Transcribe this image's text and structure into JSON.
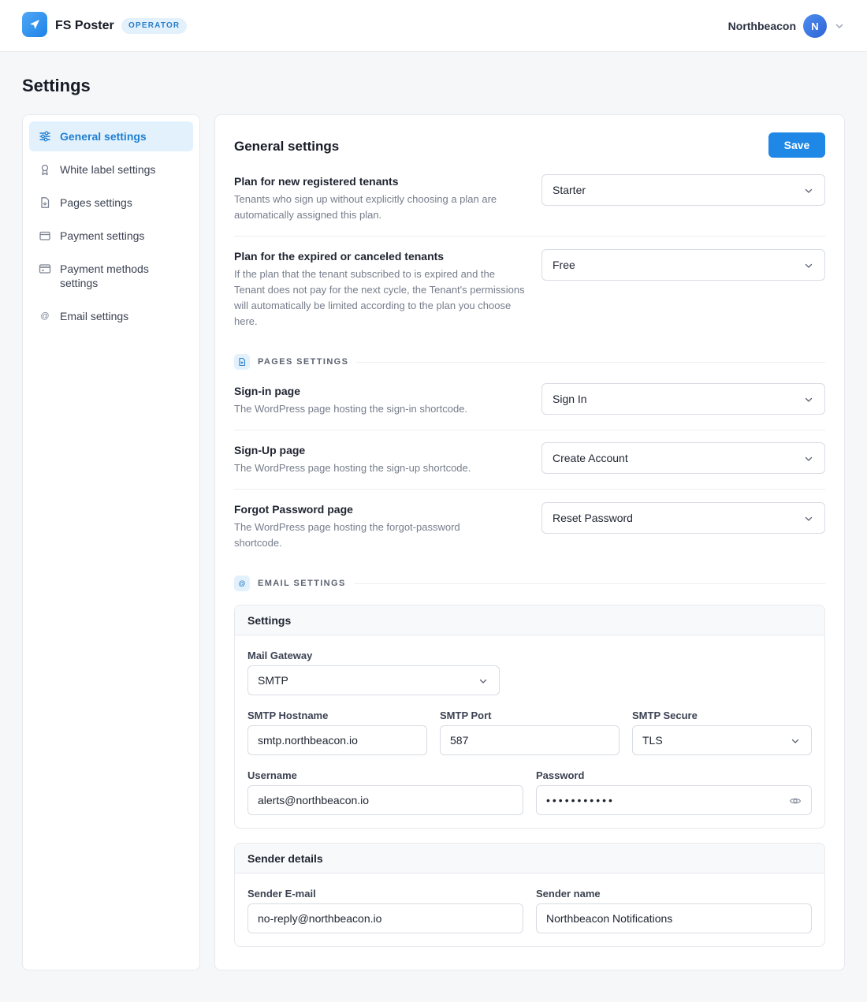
{
  "header": {
    "app_name": "FS Poster",
    "role_badge": "OPERATOR",
    "user_name": "Northbeacon",
    "avatar_initial": "N"
  },
  "page_title": "Settings",
  "sidebar": {
    "items": [
      {
        "label": "General settings",
        "icon": "sliders-icon",
        "active": true
      },
      {
        "label": "White label settings",
        "icon": "badge-icon"
      },
      {
        "label": "Pages settings",
        "icon": "document-icon"
      },
      {
        "label": "Payment settings",
        "icon": "wallet-icon"
      },
      {
        "label": "Payment methods settings",
        "icon": "credit-card-icon"
      },
      {
        "label": "Email settings",
        "icon": "at-sign-icon"
      }
    ]
  },
  "main": {
    "title": "General settings",
    "save_label": "Save",
    "plan_new": {
      "label": "Plan for new registered tenants",
      "description": "Tenants who sign up without explicitly choosing a plan are automatically assigned this plan.",
      "value": "Starter"
    },
    "plan_expired": {
      "label": "Plan for the expired or canceled tenants",
      "description": "If the plan that the tenant subscribed to is expired and the Tenant does not pay for the next cycle, the Tenant's permissions will automatically be limited according to the plan you choose here.",
      "value": "Free"
    },
    "pages_section": "PAGES SETTINGS",
    "signin": {
      "label": "Sign-in page",
      "description": "The WordPress page hosting the sign-in shortcode.",
      "value": "Sign In"
    },
    "signup": {
      "label": "Sign-Up page",
      "description": "The WordPress page hosting the sign-up shortcode.",
      "value": "Create Account"
    },
    "forgot": {
      "label": "Forgot Password page",
      "description": "The WordPress page hosting the forgot-password shortcode.",
      "value": "Reset Password"
    },
    "email_section": "EMAIL SETTINGS",
    "email_settings": {
      "title": "Settings",
      "gateway_label": "Mail Gateway",
      "gateway_value": "SMTP",
      "hostname_label": "SMTP Hostname",
      "hostname_value": "smtp.northbeacon.io",
      "port_label": "SMTP Port",
      "port_value": "587",
      "secure_label": "SMTP Secure",
      "secure_value": "TLS",
      "username_label": "Username",
      "username_value": "alerts@northbeacon.io",
      "password_label": "Password",
      "password_value": "•••••••••••"
    },
    "sender": {
      "title": "Sender details",
      "email_label": "Sender E-mail",
      "email_value": "no-reply@northbeacon.io",
      "name_label": "Sender name",
      "name_value": "Northbeacon Notifications"
    }
  },
  "colors": {
    "accent": "#1f87e5",
    "active_bg": "#e3f1fd",
    "active_text": "#1f7fd1"
  }
}
